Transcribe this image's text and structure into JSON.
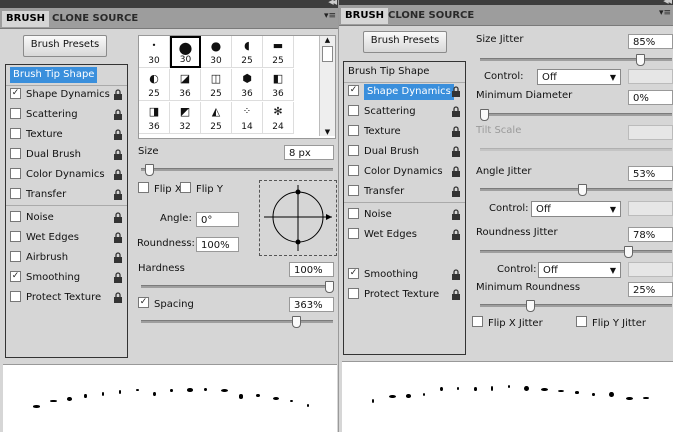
{
  "left": {
    "tabs": [
      "BRUSH",
      "CLONE SOURCE"
    ],
    "brush_presets_label": "Brush Presets",
    "list": [
      {
        "label": "Brush Tip Shape",
        "check": false,
        "checked": false,
        "selected": true
      },
      {
        "label": "Shape Dynamics",
        "check": true,
        "checked": true
      },
      {
        "label": "Scattering",
        "check": true,
        "checked": false
      },
      {
        "label": "Texture",
        "check": true,
        "checked": false
      },
      {
        "label": "Dual Brush",
        "check": true,
        "checked": false
      },
      {
        "label": "Color Dynamics",
        "check": true,
        "checked": false
      },
      {
        "label": "Transfer",
        "check": true,
        "checked": false
      },
      {
        "label": "Noise",
        "check": true,
        "checked": false
      },
      {
        "label": "Wet Edges",
        "check": true,
        "checked": false
      },
      {
        "label": "Airbrush",
        "check": true,
        "checked": false
      },
      {
        "label": "Smoothing",
        "check": true,
        "checked": true
      },
      {
        "label": "Protect Texture",
        "check": true,
        "checked": false
      }
    ],
    "brush_grid": [
      "30",
      "30",
      "30",
      "25",
      "25",
      "25",
      "36",
      "25",
      "36",
      "36",
      "36",
      "32",
      "25",
      "14",
      "24"
    ],
    "size_label": "Size",
    "size_value": "8 px",
    "size_level": 0.02,
    "flip_x": "Flip X",
    "flip_y": "Flip Y",
    "angle_label": "Angle:",
    "angle_value": "0°",
    "roundness_label": "Roundness:",
    "roundness_value": "100%",
    "hardness_label": "Hardness",
    "hardness_value": "100%",
    "hardness_level": 1.0,
    "spacing_label": "Spacing",
    "spacing_value": "363%",
    "spacing_level": 0.82
  },
  "right": {
    "tabs": [
      "BRUSH",
      "CLONE SOURCE"
    ],
    "brush_presets_label": "Brush Presets",
    "list": [
      {
        "label": "Brush Tip Shape",
        "check": false,
        "checked": false
      },
      {
        "label": "Shape Dynamics",
        "check": true,
        "checked": true,
        "selected": true
      },
      {
        "label": "Scattering",
        "check": true,
        "checked": false
      },
      {
        "label": "Texture",
        "check": true,
        "checked": false
      },
      {
        "label": "Dual Brush",
        "check": true,
        "checked": false
      },
      {
        "label": "Color Dynamics",
        "check": true,
        "checked": false
      },
      {
        "label": "Transfer",
        "check": true,
        "checked": false
      },
      {
        "label": "Noise",
        "check": true,
        "checked": false
      },
      {
        "label": "Wet Edges",
        "check": true,
        "checked": false
      },
      {
        "label": "Smoothing",
        "check": true,
        "checked": true
      },
      {
        "label": "Protect Texture",
        "check": true,
        "checked": false
      }
    ],
    "size_jitter_label": "Size Jitter",
    "size_jitter_value": "85%",
    "size_jitter_level": 0.85,
    "control_label": "Control:",
    "control_off": "Off",
    "min_diameter_label": "Minimum Diameter",
    "min_diameter_value": "0%",
    "tilt_scale_label": "Tilt Scale",
    "angle_jitter_label": "Angle Jitter",
    "angle_jitter_value": "53%",
    "angle_jitter_level": 0.53,
    "roundness_jitter_label": "Roundness Jitter",
    "roundness_jitter_value": "78%",
    "roundness_jitter_level": 0.78,
    "min_roundness_label": "Minimum Roundness",
    "min_roundness_value": "25%",
    "min_roundness_level": 0.25,
    "flip_x_jitter": "Flip X Jitter",
    "flip_y_jitter": "Flip Y Jitter"
  }
}
